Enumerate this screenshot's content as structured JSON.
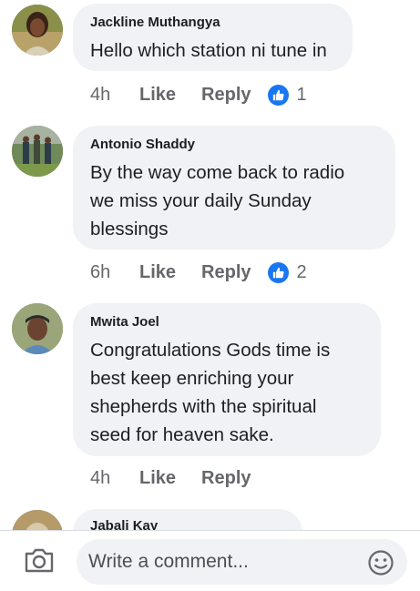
{
  "comments": [
    {
      "author": "Jackline Muthangya",
      "lines": [
        "Hello which station ni tune in"
      ],
      "time": "4h",
      "like_label": "Like",
      "reply_label": "Reply",
      "reactions": "1"
    },
    {
      "author": "Antonio Shaddy",
      "lines": [
        "By the way come back to radio",
        "we miss your daily Sunday",
        "blessings"
      ],
      "time": "6h",
      "like_label": "Like",
      "reply_label": "Reply",
      "reactions": "2"
    },
    {
      "author": "Mwita Joel",
      "lines": [
        "Congratulations Gods time is",
        "best keep enriching your",
        "shepherds with the spiritual",
        "seed for heaven sake."
      ],
      "time": "4h",
      "like_label": "Like",
      "reply_label": "Reply",
      "reactions": ""
    },
    {
      "author": "Jabali Kay"
    }
  ],
  "composer": {
    "placeholder": "Write a comment...",
    "camera_icon": "camera-icon",
    "emoji_icon": "emoji-icon"
  },
  "colors": {
    "bubble": "#f0f2f5",
    "like_blue": "#1877f2",
    "meta_gray": "#65676b"
  }
}
